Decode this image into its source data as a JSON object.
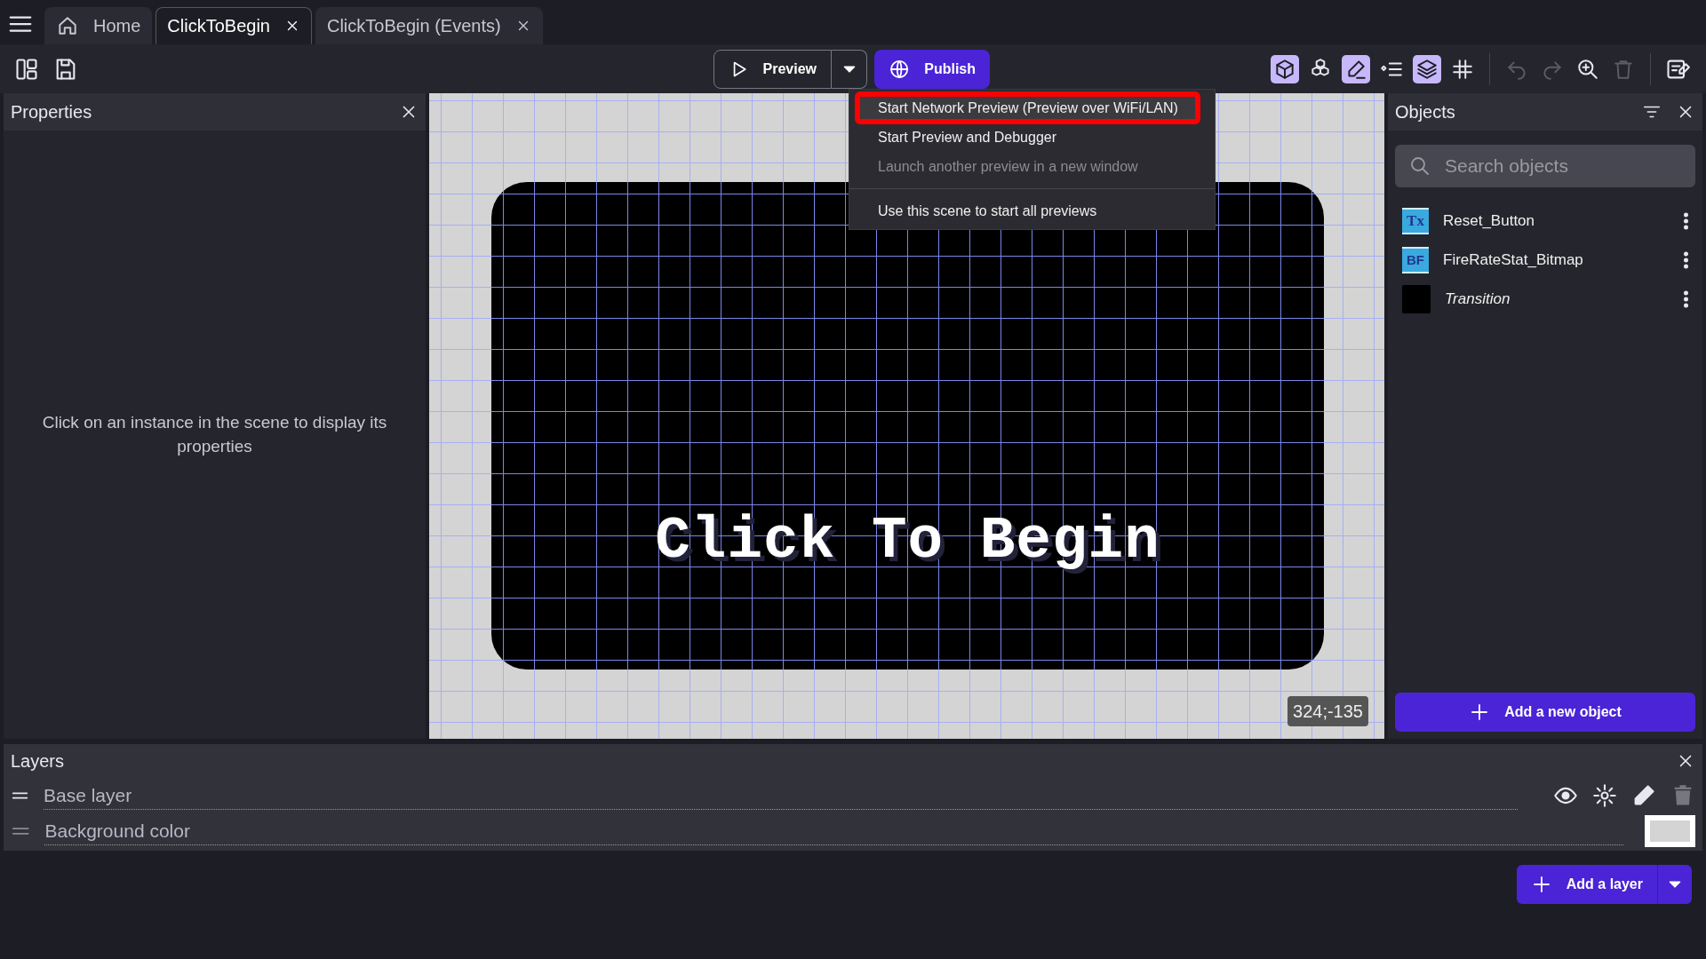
{
  "tabs": [
    {
      "label": "Home",
      "kind": "home",
      "selected": false,
      "closable": false
    },
    {
      "label": "ClickToBegin",
      "kind": "scene",
      "selected": true,
      "closable": true
    },
    {
      "label": "ClickToBegin (Events)",
      "kind": "events",
      "selected": false,
      "closable": true
    }
  ],
  "toolbar": {
    "preview_label": "Preview",
    "publish_label": "Publish",
    "tools": [
      {
        "on": true
      },
      {
        "on": false
      },
      {
        "on": true
      },
      {
        "on": false
      },
      {
        "on": true
      },
      {
        "on": false
      }
    ],
    "actions": [
      {
        "disabled": true
      },
      {
        "disabled": true
      },
      {
        "disabled": false
      },
      {
        "disabled": true
      }
    ]
  },
  "preview_menu": [
    {
      "kind": "item",
      "label": "Start Network Preview (Preview over WiFi/LAN)",
      "selected": true,
      "disabled": false
    },
    {
      "kind": "item",
      "label": "Start Preview and Debugger",
      "selected": false,
      "disabled": false
    },
    {
      "kind": "item",
      "label": "Launch another preview in a new window",
      "selected": false,
      "disabled": true
    },
    {
      "kind": "divider"
    },
    {
      "kind": "item",
      "label": "Use this scene to start all previews",
      "selected": false,
      "disabled": false
    }
  ],
  "properties": {
    "title": "Properties",
    "message": "Click on an instance in the scene to display its properties"
  },
  "scene": {
    "text": "Click To Begin",
    "coordinates": "324;-135"
  },
  "objects": {
    "title": "Objects",
    "search_placeholder": "Search objects",
    "items": [
      {
        "name": "Reset_Button",
        "kind": "text",
        "icon_text": "Tx",
        "italic": false
      },
      {
        "name": "FireRateStat_Bitmap",
        "kind": "bitmap-text",
        "icon_text": "BF",
        "italic": false
      },
      {
        "name": "Transition",
        "kind": "sprite",
        "italic": true
      }
    ],
    "add_label": "Add a new object"
  },
  "layers": {
    "title": "Layers",
    "items": [
      {
        "name": "Base layer",
        "kind": "layer"
      },
      {
        "name": "Background color",
        "kind": "background",
        "color": "#d4d4d4"
      }
    ],
    "add_label": "Add a layer"
  }
}
